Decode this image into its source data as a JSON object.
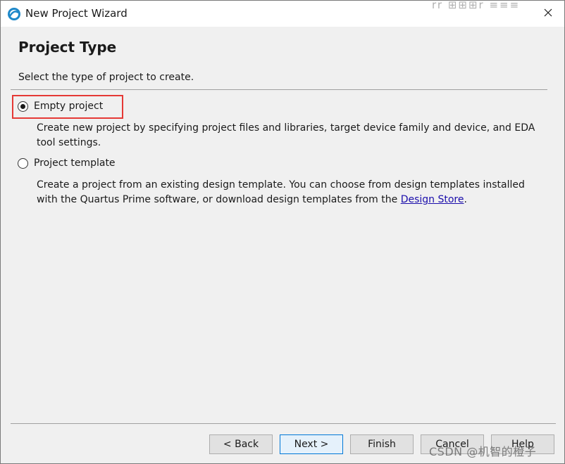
{
  "window": {
    "title": "New Project Wizard",
    "title_overlay_glyphs": "rr ⊞⊞⊞r  ≡≡≡"
  },
  "page": {
    "heading": "Project Type",
    "instruction": "Select the type of project to create."
  },
  "options": [
    {
      "label": "Empty project",
      "checked": true,
      "description": "Create new project by specifying project files and libraries, target device family and device, and EDA tool settings."
    },
    {
      "label": "Project template",
      "checked": false,
      "description_before_link": "Create a project from an existing design template. You can choose from design templates installed with the Quartus Prime software, or download design templates from the ",
      "link_text": "Design Store",
      "description_after_link": "."
    }
  ],
  "buttons": {
    "back": "< Back",
    "next": "Next >",
    "finish": "Finish",
    "cancel": "Cancel",
    "help": "Help"
  },
  "watermark": "CSDN @机智的橙子",
  "colors": {
    "highlight_box": "#e53935",
    "link": "#1a0dab",
    "default_button_border": "#0078d7"
  }
}
